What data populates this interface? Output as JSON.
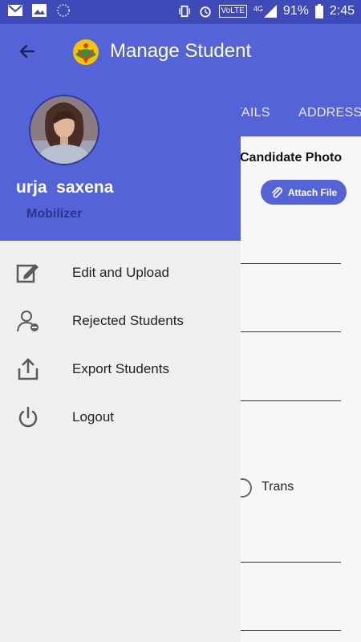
{
  "status_bar": {
    "icons_left": [
      "gmail-icon",
      "image-icon",
      "sync-icon"
    ],
    "icons_right": [
      "vibrate-icon",
      "alarm-icon",
      "volte-icon",
      "signal-4g-icon",
      "battery-icon"
    ],
    "volte_label": "VoLTE",
    "network_label": "4G",
    "battery": "91%",
    "time": "2:45"
  },
  "app_bar": {
    "title": "Manage Student",
    "tabs": [
      {
        "label": "TAILS"
      },
      {
        "label": "ADDRESS"
      }
    ]
  },
  "drawer": {
    "user": {
      "name": "urja  saxena",
      "role": "Mobilizer"
    },
    "menu": [
      {
        "label": "Edit and Upload",
        "icon": "edit-icon"
      },
      {
        "label": "Rejected Students",
        "icon": "rejected-user-icon"
      },
      {
        "label": "Export Students",
        "icon": "export-icon"
      },
      {
        "label": "Logout",
        "icon": "power-icon"
      }
    ]
  },
  "form": {
    "candidate_photo_label": "Candidate Photo",
    "attach_button": "Attach File",
    "gender_option": "Trans"
  },
  "colors": {
    "primary": "#5563d8",
    "status_bar": "#3d4ab8",
    "drawer_bg": "#efefef"
  }
}
